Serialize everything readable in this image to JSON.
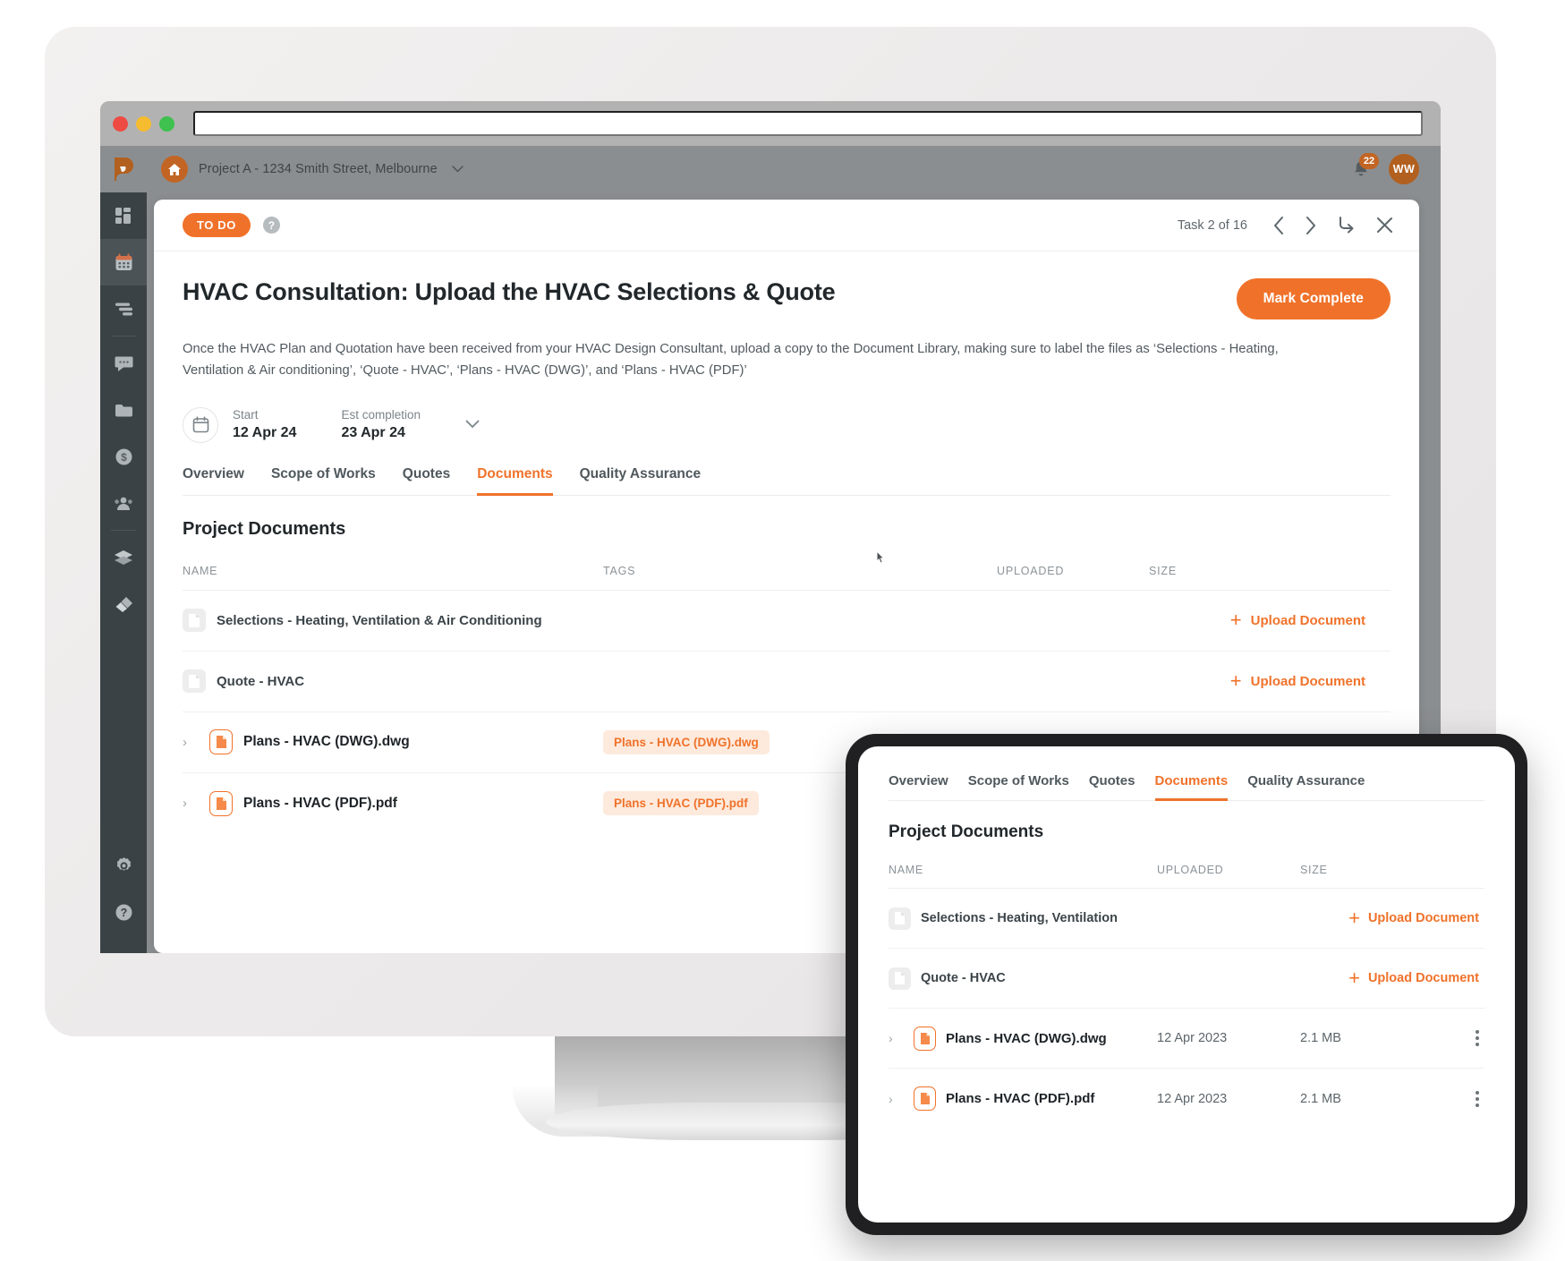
{
  "browser": {
    "traffic_lights": [
      "close",
      "minimize",
      "maximize"
    ],
    "url_value": "",
    "url_placeholder": ""
  },
  "sidebar": {
    "logo": "buildertrend-logo",
    "items": [
      {
        "icon": "dashboard-grid-icon",
        "label": "Dashboard",
        "active": false
      },
      {
        "icon": "calendar-icon",
        "label": "Schedule",
        "active": true
      },
      {
        "icon": "tasks-list-icon",
        "label": "To-dos",
        "active": false
      },
      {
        "icon": "chat-bubble-icon",
        "label": "Messages",
        "active": false
      },
      {
        "icon": "folder-icon",
        "label": "Documents",
        "active": false
      },
      {
        "icon": "dollar-circle-icon",
        "label": "Financials",
        "active": false
      },
      {
        "icon": "people-icon",
        "label": "Contacts",
        "active": false
      },
      {
        "icon": "layers-icon",
        "label": "Selections",
        "active": false
      },
      {
        "icon": "paint-brush-icon",
        "label": "Trades",
        "active": false
      }
    ],
    "bottom_items": [
      {
        "icon": "gear-icon",
        "label": "Settings"
      },
      {
        "icon": "question-circle-icon",
        "label": "Help"
      }
    ]
  },
  "topbar": {
    "home_icon": "home-icon",
    "project_name": "Project A - 1234 Smith Street, Melbourne",
    "chevron": "⌄",
    "bell_icon": "bell-icon",
    "notification_count": "22",
    "avatar_initials": "WW"
  },
  "task": {
    "status": "TO DO",
    "help": "?",
    "counter": "Task 2 of 16",
    "prev_icon": "chevron-left-icon",
    "next_icon": "chevron-right-icon",
    "collapse_icon": "collapse-arrow-icon",
    "close_icon": "close-x-icon",
    "title": "HVAC Consultation: Upload the HVAC Selections & Quote",
    "mark_complete_label": "Mark Complete",
    "description": "Once the HVAC Plan and Quotation have been received from your HVAC Design Consultant, upload a copy to the Document Library, making sure to label the files as ‘Selections - Heating, Ventilation & Air conditioning’, ‘Quote - HVAC’, ‘Plans - HVAC (DWG)’, and ‘Plans - HVAC (PDF)’",
    "dates": {
      "calendar_icon": "calendar-icon",
      "start_label": "Start",
      "start_value": "12 Apr 24",
      "end_label": "Est completion",
      "end_value": "23 Apr 24",
      "expand_icon": "chevron-down-icon"
    },
    "tabs": [
      {
        "label": "Overview",
        "active": false
      },
      {
        "label": "Scope of Works",
        "active": false
      },
      {
        "label": "Quotes",
        "active": false
      },
      {
        "label": "Documents",
        "active": true
      },
      {
        "label": "Quality Assurance",
        "active": false
      }
    ]
  },
  "documents": {
    "section_title": "Project Documents",
    "columns": [
      "NAME",
      "TAGS",
      "UPLOADED",
      "SIZE"
    ],
    "upload_label": "Upload Document",
    "rows": [
      {
        "name": "Selections - Heating, Ventilation & Air Conditioning",
        "icon": "document-placeholder-icon",
        "tag": "",
        "uploaded": "",
        "size": "",
        "action": "upload",
        "expandable": false
      },
      {
        "name": "Quote - HVAC",
        "icon": "document-placeholder-icon",
        "tag": "",
        "uploaded": "",
        "size": "",
        "action": "upload",
        "expandable": false
      },
      {
        "name": "Plans - HVAC (DWG).dwg",
        "icon": "file-document-icon",
        "tag": "Plans - HVAC (DWG).dwg",
        "uploaded": "",
        "size": "",
        "action": "",
        "expandable": true
      },
      {
        "name": "Plans - HVAC (PDF).pdf",
        "icon": "file-document-icon",
        "tag": "Plans - HVAC (PDF).pdf",
        "uploaded": "",
        "size": "",
        "action": "",
        "expandable": true
      }
    ]
  },
  "tablet": {
    "tabs": [
      {
        "label": "Overview",
        "active": false
      },
      {
        "label": "Scope of Works",
        "active": false
      },
      {
        "label": "Quotes",
        "active": false
      },
      {
        "label": "Documents",
        "active": true
      },
      {
        "label": "Quality Assurance",
        "active": false
      }
    ],
    "section_title": "Project Documents",
    "columns": [
      "NAME",
      "UPLOADED",
      "SIZE"
    ],
    "upload_label": "Upload Document",
    "rows": [
      {
        "name": "Selections - Heating, Ventilation",
        "icon": "document-placeholder-icon",
        "uploaded": "",
        "size": "",
        "action": "upload",
        "expandable": false
      },
      {
        "name": "Quote - HVAC",
        "icon": "document-placeholder-icon",
        "uploaded": "",
        "size": "",
        "action": "upload",
        "expandable": false
      },
      {
        "name": "Plans - HVAC (DWG).dwg",
        "icon": "file-document-icon",
        "uploaded": "12 Apr 2023",
        "size": "2.1 MB",
        "action": "kebab",
        "expandable": true
      },
      {
        "name": "Plans - HVAC (PDF).pdf",
        "icon": "file-document-icon",
        "uploaded": "12 Apr 2023",
        "size": "2.1 MB",
        "action": "kebab",
        "expandable": true
      }
    ]
  },
  "colors": {
    "accent": "#f0722a",
    "accent_dark": "#c26524",
    "sidebar": "#3b4245",
    "chrome": "#8b8e90",
    "tag_bg": "#fdeadd"
  }
}
